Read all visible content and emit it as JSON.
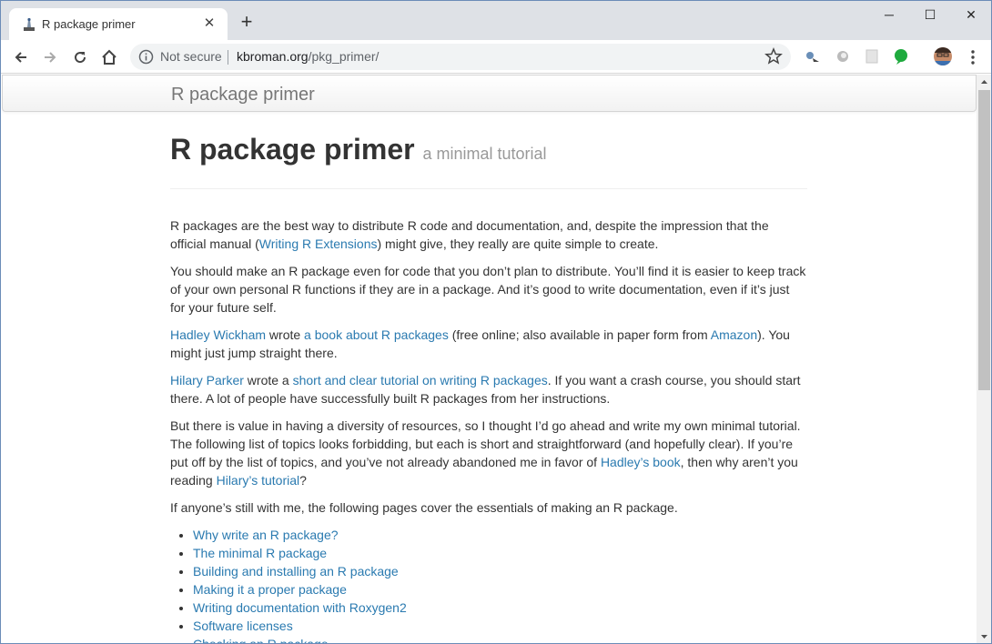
{
  "browser": {
    "tab_title": "R package primer",
    "tab_close": "✕",
    "new_tab": "+",
    "minimize": "─",
    "maximize": "☐",
    "close": "✕",
    "security_label": "Not secure",
    "url_host": "kbroman.org",
    "url_path": "/pkg_primer/"
  },
  "page": {
    "brand": "R package primer",
    "title": "R package primer",
    "subtitle": "a minimal tutorial",
    "p1": {
      "a": "R packages are the best way to distribute R code and documentation, and, despite the impression that the official manual (",
      "link": "Writing R Extensions",
      "b": ") might give, they really are quite simple to create."
    },
    "p2": "You should make an R package even for code that you don’t plan to distribute. You’ll find it is easier to keep track of your own personal R functions if they are in a package. And it’s good to write documentation, even if it’s just for your future self.",
    "p3": {
      "link1": "Hadley Wickham",
      "a": " wrote ",
      "link2": "a book about R packages",
      "b": " (free online; also available in paper form from ",
      "link3": "Amazon",
      "c": "). You might just jump straight there."
    },
    "p4": {
      "link1": "Hilary Parker",
      "a": " wrote a ",
      "link2": "short and clear tutorial on writing R packages",
      "b": ". If you want a crash course, you should start there. A lot of people have successfully built R packages from her instructions."
    },
    "p5": {
      "a": "But there is value in having a diversity of resources, so I thought I’d go ahead and write my own minimal tutorial. The following list of topics looks forbidding, but each is short and straightforward (and hopefully clear). If you’re put off by the list of topics, and you’ve not already abandoned me in favor of ",
      "link1": "Hadley’s book",
      "b": ", then why aren’t you reading ",
      "link2": "Hilary’s tutorial",
      "c": "?"
    },
    "p6": "If anyone’s still with me, the following pages cover the essentials of making an R package.",
    "topics": [
      "Why write an R package?",
      "The minimal R package",
      "Building and installing an R package",
      "Making it a proper package",
      "Writing documentation with Roxygen2",
      "Software licenses",
      "Checking an R package"
    ]
  },
  "colors": {
    "link": "#2a7ab0",
    "text": "#333333",
    "subtitle": "#999999",
    "chrome": "#dee1e6"
  }
}
